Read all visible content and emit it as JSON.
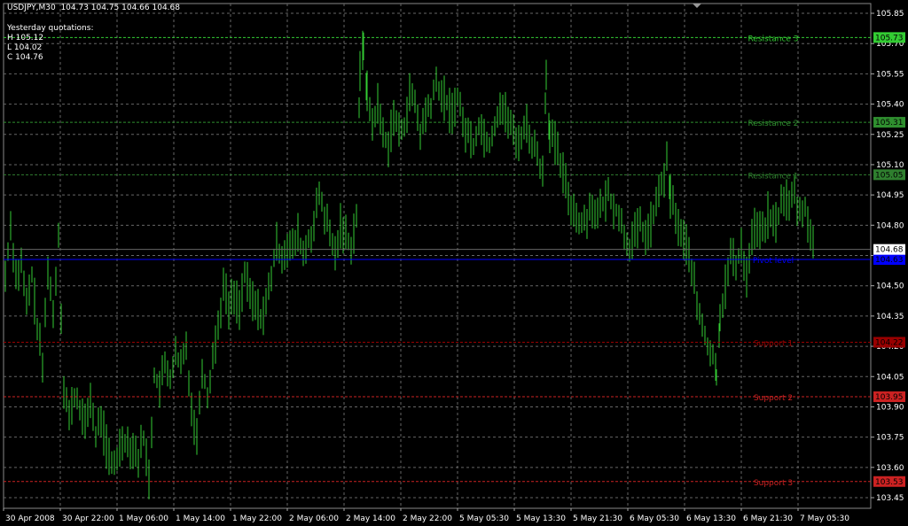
{
  "header": {
    "symbol": "USDJPY,M30",
    "ohlc": "104.73 104.75 104.66 104.68"
  },
  "yesterday": {
    "title": "Yesterday quotations:",
    "high": "H 105.12",
    "low": "L 104.02",
    "close": "C 104.76"
  },
  "colors": {
    "background": "#000000",
    "candles": "#33cc33",
    "grid": "#666666",
    "axis_text": "#ffffff",
    "pivot": "#0000ff",
    "resistance3": "#33cc33",
    "resistance2": "#2f8f2f",
    "resistance1": "#2f7f2f",
    "support1": "#990000",
    "support2": "#cc2222",
    "support3": "#cc2222"
  },
  "chart_data": {
    "type": "ohlc",
    "ylim": [
      103.4,
      105.83
    ],
    "y_ticks": [
      "105.85",
      "105.70",
      "105.55",
      "105.40",
      "105.25",
      "105.10",
      "104.95",
      "104.80",
      "104.65",
      "104.50",
      "104.35",
      "104.20",
      "104.05",
      "103.90",
      "103.75",
      "103.60",
      "103.45"
    ],
    "x_ticks": [
      "30 Apr 2008",
      "30 Apr 22:00",
      "1 May 06:00",
      "1 May 14:00",
      "1 May 22:00",
      "2 May 06:00",
      "2 May 14:00",
      "2 May 22:00",
      "5 May 05:30",
      "5 May 13:30",
      "5 May 21:30",
      "6 May 05:30",
      "6 May 13:30",
      "6 May 21:30",
      "7 May 05:30"
    ],
    "current_price": "104.68",
    "levels": [
      {
        "name": "Resistance 3",
        "value": 105.73,
        "tag": "105.73",
        "key": "resistance3"
      },
      {
        "name": "Resistance 2",
        "value": 105.31,
        "tag": "105.31",
        "key": "resistance2"
      },
      {
        "name": "Resistance 1",
        "value": 105.05,
        "tag": "105.05",
        "key": "resistance1"
      },
      {
        "name": "Pivot level",
        "value": 104.63,
        "tag": "104.63",
        "key": "pivot"
      },
      {
        "name": "Support 1",
        "value": 104.22,
        "tag": "104.22",
        "key": "support1"
      },
      {
        "name": "Support 2",
        "value": 103.95,
        "tag": "103.95",
        "key": "support2"
      },
      {
        "name": "Support 3",
        "value": 103.53,
        "tag": "103.53",
        "key": "support3"
      }
    ],
    "close_path": [
      [
        0,
        104.55
      ],
      [
        6,
        104.8
      ],
      [
        12,
        104.55
      ],
      [
        18,
        104.6
      ],
      [
        24,
        104.4
      ],
      [
        30,
        104.55
      ],
      [
        36,
        104.3
      ],
      [
        42,
        104.1
      ],
      [
        48,
        104.6
      ],
      [
        54,
        104.35
      ],
      [
        60,
        104.75
      ],
      [
        66,
        104.0
      ],
      [
        72,
        103.85
      ],
      [
        78,
        103.95
      ],
      [
        84,
        103.9
      ],
      [
        90,
        103.8
      ],
      [
        96,
        103.95
      ],
      [
        102,
        103.75
      ],
      [
        108,
        103.85
      ],
      [
        114,
        103.7
      ],
      [
        120,
        103.6
      ],
      [
        126,
        103.65
      ],
      [
        132,
        103.75
      ],
      [
        138,
        103.72
      ],
      [
        144,
        103.7
      ],
      [
        150,
        103.65
      ],
      [
        156,
        103.75
      ],
      [
        162,
        103.55
      ],
      [
        168,
        104.05
      ],
      [
        174,
        104.0
      ],
      [
        180,
        104.1
      ],
      [
        186,
        104.05
      ],
      [
        192,
        104.15
      ],
      [
        198,
        104.1
      ],
      [
        204,
        104.2
      ],
      [
        210,
        103.9
      ],
      [
        216,
        103.75
      ],
      [
        222,
        104.1
      ],
      [
        228,
        103.95
      ],
      [
        234,
        104.15
      ],
      [
        240,
        104.3
      ],
      [
        246,
        104.5
      ],
      [
        252,
        104.4
      ],
      [
        258,
        104.45
      ],
      [
        264,
        104.4
      ],
      [
        270,
        104.55
      ],
      [
        276,
        104.45
      ],
      [
        282,
        104.4
      ],
      [
        288,
        104.35
      ],
      [
        294,
        104.4
      ],
      [
        300,
        104.55
      ],
      [
        306,
        104.7
      ],
      [
        312,
        104.65
      ],
      [
        318,
        104.7
      ],
      [
        324,
        104.68
      ],
      [
        330,
        104.75
      ],
      [
        336,
        104.65
      ],
      [
        342,
        104.72
      ],
      [
        348,
        104.8
      ],
      [
        354,
        104.95
      ],
      [
        360,
        104.85
      ],
      [
        366,
        104.75
      ],
      [
        372,
        104.65
      ],
      [
        378,
        104.8
      ],
      [
        384,
        104.75
      ],
      [
        390,
        104.7
      ],
      [
        396,
        104.85
      ],
      [
        400,
        105.55
      ],
      [
        404,
        105.7
      ],
      [
        408,
        105.45
      ],
      [
        414,
        105.3
      ],
      [
        420,
        105.4
      ],
      [
        426,
        105.25
      ],
      [
        432,
        105.2
      ],
      [
        438,
        105.35
      ],
      [
        444,
        105.25
      ],
      [
        450,
        105.3
      ],
      [
        456,
        105.45
      ],
      [
        462,
        105.4
      ],
      [
        468,
        105.25
      ],
      [
        474,
        105.35
      ],
      [
        480,
        105.4
      ],
      [
        486,
        105.5
      ],
      [
        492,
        105.45
      ],
      [
        498,
        105.4
      ],
      [
        504,
        105.35
      ],
      [
        510,
        105.45
      ],
      [
        516,
        105.3
      ],
      [
        522,
        105.25
      ],
      [
        528,
        105.2
      ],
      [
        534,
        105.3
      ],
      [
        540,
        105.25
      ],
      [
        546,
        105.2
      ],
      [
        552,
        105.3
      ],
      [
        558,
        105.4
      ],
      [
        564,
        105.35
      ],
      [
        570,
        105.3
      ],
      [
        576,
        105.2
      ],
      [
        582,
        105.25
      ],
      [
        588,
        105.3
      ],
      [
        594,
        105.2
      ],
      [
        600,
        105.15
      ],
      [
        606,
        105.05
      ],
      [
        610,
        105.55
      ],
      [
        614,
        105.25
      ],
      [
        620,
        105.2
      ],
      [
        626,
        105.1
      ],
      [
        632,
        105.0
      ],
      [
        638,
        104.9
      ],
      [
        644,
        104.85
      ],
      [
        650,
        104.8
      ],
      [
        656,
        104.85
      ],
      [
        662,
        104.9
      ],
      [
        668,
        104.85
      ],
      [
        674,
        104.9
      ],
      [
        680,
        104.95
      ],
      [
        686,
        104.9
      ],
      [
        692,
        104.85
      ],
      [
        698,
        104.75
      ],
      [
        704,
        104.7
      ],
      [
        710,
        104.75
      ],
      [
        716,
        104.8
      ],
      [
        722,
        104.75
      ],
      [
        728,
        104.8
      ],
      [
        734,
        104.9
      ],
      [
        740,
        105.0
      ],
      [
        746,
        105.1
      ],
      [
        750,
        104.95
      ],
      [
        756,
        104.85
      ],
      [
        762,
        104.75
      ],
      [
        768,
        104.7
      ],
      [
        774,
        104.6
      ],
      [
        780,
        104.4
      ],
      [
        786,
        104.3
      ],
      [
        792,
        104.2
      ],
      [
        798,
        104.15
      ],
      [
        802,
        104.05
      ],
      [
        806,
        104.35
      ],
      [
        812,
        104.5
      ],
      [
        818,
        104.65
      ],
      [
        824,
        104.6
      ],
      [
        830,
        104.7
      ],
      [
        836,
        104.55
      ],
      [
        842,
        104.75
      ],
      [
        848,
        104.8
      ],
      [
        854,
        104.75
      ],
      [
        860,
        104.85
      ],
      [
        866,
        104.8
      ],
      [
        872,
        104.85
      ],
      [
        878,
        104.95
      ],
      [
        884,
        104.9
      ],
      [
        890,
        104.95
      ],
      [
        896,
        104.85
      ],
      [
        902,
        104.9
      ],
      [
        908,
        104.75
      ],
      [
        912,
        104.68
      ]
    ]
  }
}
